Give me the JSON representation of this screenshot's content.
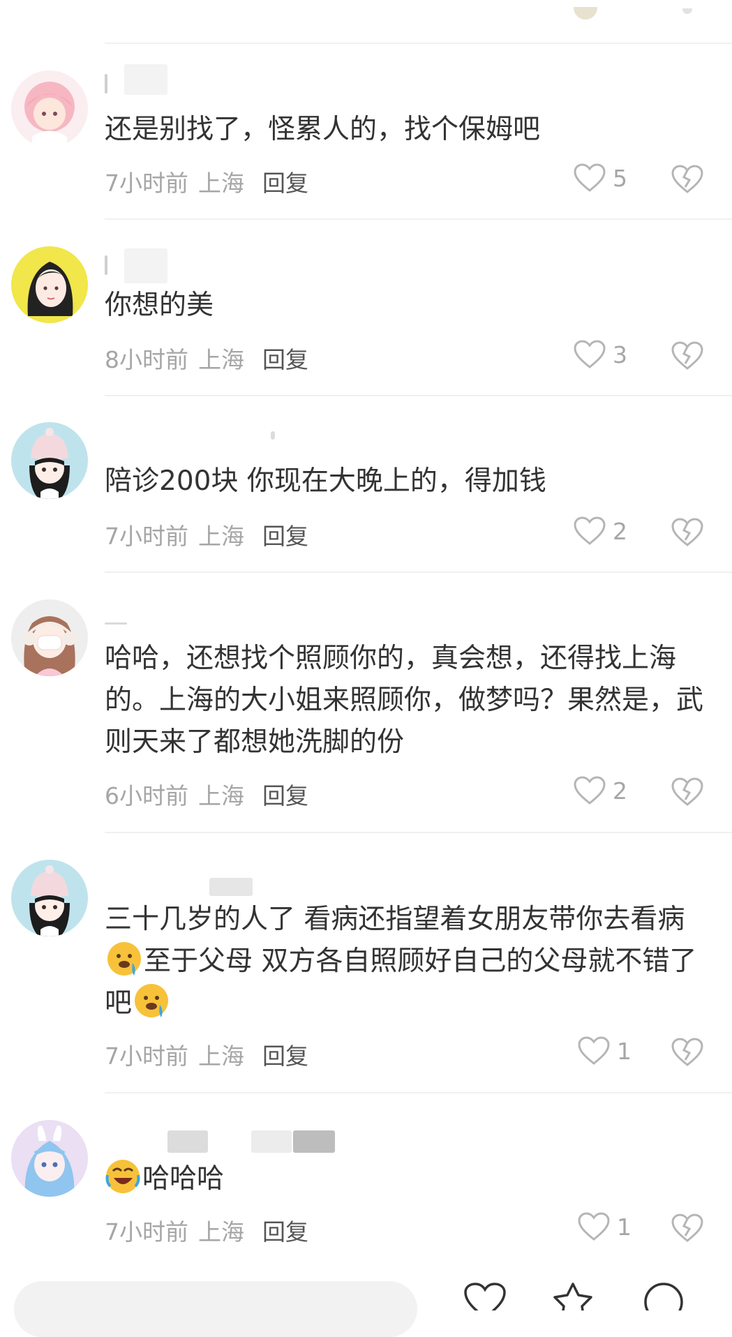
{
  "comments": [
    {
      "text": "还是别找了，怪累人的，找个保姆吧",
      "time": "7小时前",
      "location": "上海",
      "reply": "回复",
      "likes": "5",
      "avatar": "pink-hair-girl-avatar"
    },
    {
      "text": "你想的美",
      "time": "8小时前",
      "location": "上海",
      "reply": "回复",
      "likes": "3",
      "avatar": "black-hair-woman-avatar"
    },
    {
      "text": "陪诊200块 你现在大晚上的，得加钱",
      "time": "7小时前",
      "location": "上海",
      "reply": "回复",
      "likes": "2",
      "avatar": "beanie-girl-avatar"
    },
    {
      "text": "哈哈，还想找个照顾你的，真会想，还得找上海的。上海的大小姐来照顾你，做梦吗？果然是，武则天来了都想她洗脚的份",
      "time": "6小时前",
      "location": "上海",
      "reply": "回复",
      "likes": "2",
      "avatar": "earmuff-girl-avatar"
    },
    {
      "text_parts": [
        "三十几岁的人了 看病还指望着女朋友带你去看病",
        "至于父母 双方各自照顾好自己的父母就不错了吧",
        ""
      ],
      "time": "7小时前",
      "location": "上海",
      "reply": "回复",
      "likes": "1",
      "avatar": "beanie-girl-avatar",
      "emoji": "drooling-face-icon"
    },
    {
      "text_parts": [
        "",
        "哈哈哈"
      ],
      "time": "7小时前",
      "location": "上海",
      "reply": "回复",
      "likes": "1",
      "avatar": "blue-hair-bunny-avatar",
      "emoji": "rolling-laughing-icon"
    }
  ],
  "colors": {
    "meta": "#a6a6a6",
    "text": "#333333",
    "reply": "#555555",
    "divider": "#f0f0f0"
  }
}
